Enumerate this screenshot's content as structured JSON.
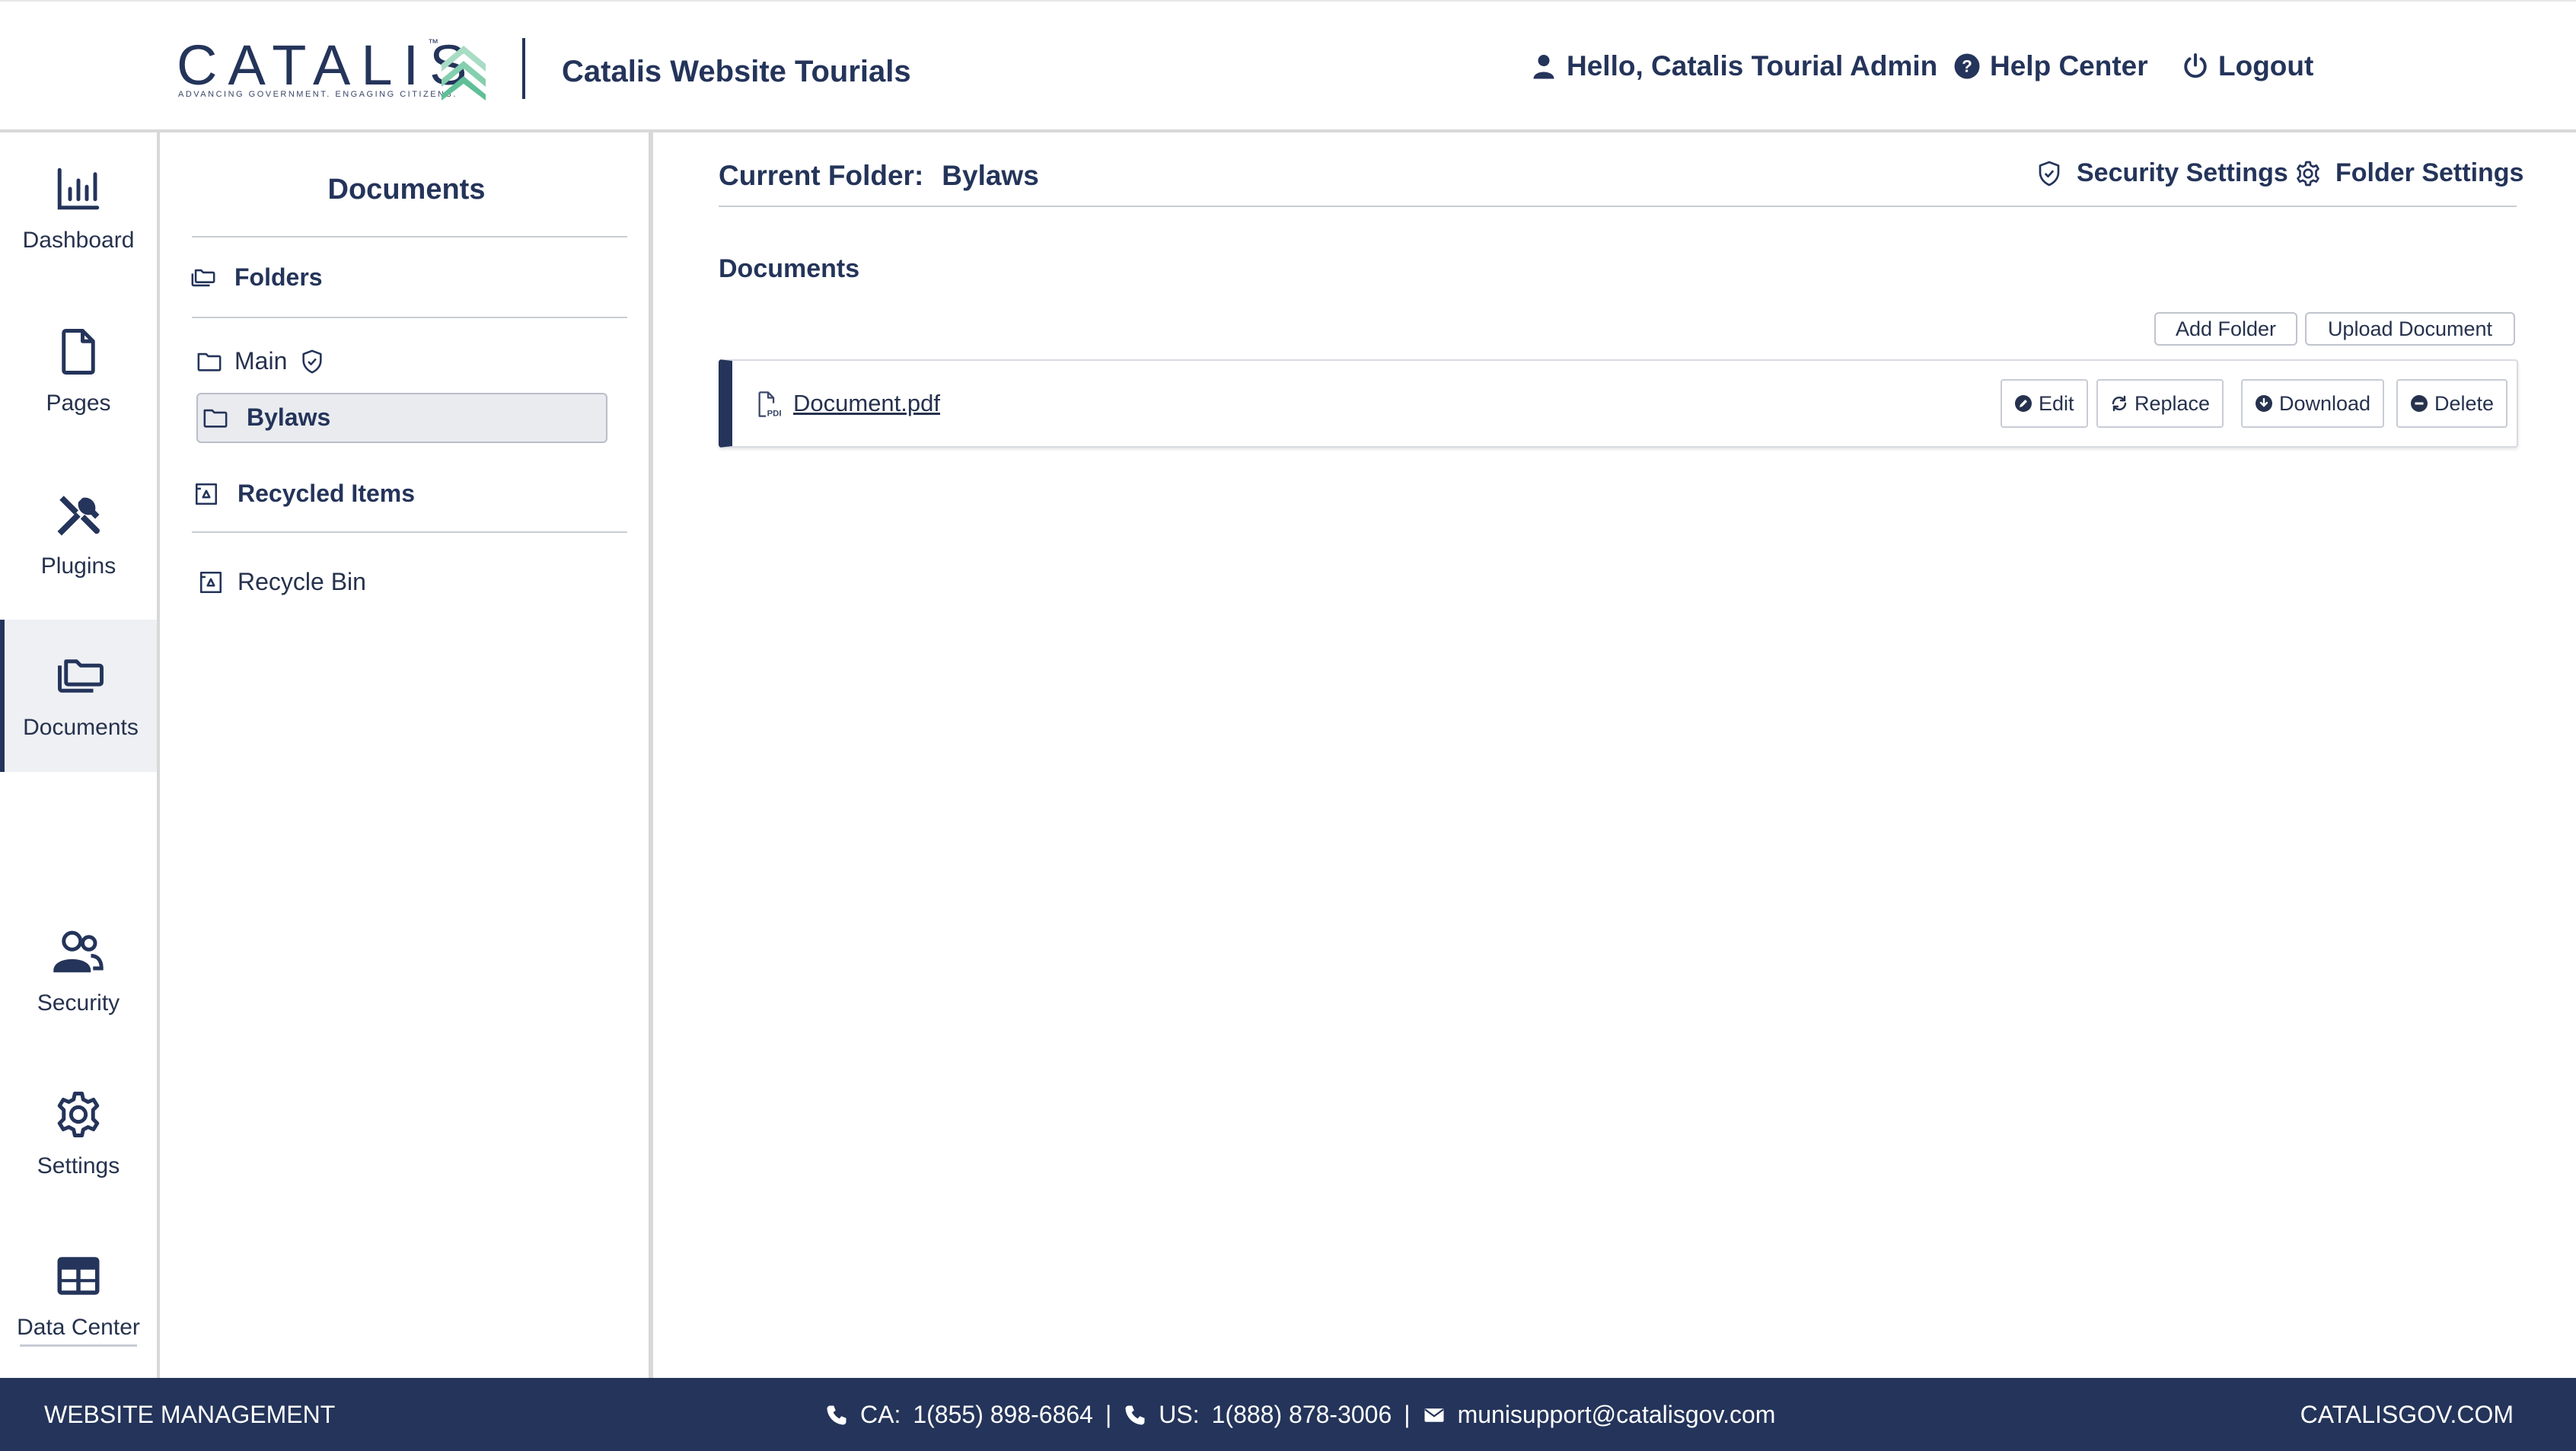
{
  "header": {
    "logo_text": "CATALIS",
    "logo_tagline": "ADVANCING GOVERNMENT. ENGAGING CITIZENS.",
    "app_title": "Catalis Website Tourials",
    "greeting": "Hello, Catalis Tourial Admin",
    "help_label": "Help Center",
    "logout_label": "Logout"
  },
  "nav": {
    "items": [
      {
        "label": "Dashboard",
        "icon": "bar-chart-icon"
      },
      {
        "label": "Pages",
        "icon": "page-icon"
      },
      {
        "label": "Plugins",
        "icon": "tools-icon"
      },
      {
        "label": "Documents",
        "icon": "folders-icon",
        "active": true
      },
      {
        "label": "Security",
        "icon": "users-icon"
      },
      {
        "label": "Settings",
        "icon": "gear-icon"
      },
      {
        "label": "Data Center",
        "icon": "table-icon"
      }
    ]
  },
  "panel": {
    "title": "Documents",
    "folders_heading": "Folders",
    "folders": [
      {
        "name": "Main",
        "secured": true
      },
      {
        "name": "Bylaws",
        "selected": true
      }
    ],
    "recycled_heading": "Recycled Items",
    "recycle_bin": "Recycle Bin"
  },
  "main": {
    "current_folder_label": "Current Folder:",
    "current_folder_value": "Bylaws",
    "security_settings_label": "Security Settings",
    "folder_settings_label": "Folder Settings",
    "documents_heading": "Documents",
    "add_folder_label": "Add Folder",
    "upload_document_label": "Upload Document",
    "documents": [
      {
        "name": "Document.pdf",
        "type": "PDF"
      }
    ],
    "actions": {
      "edit": "Edit",
      "replace": "Replace",
      "download": "Download",
      "delete": "Delete"
    }
  },
  "footer": {
    "left": "WEBSITE MANAGEMENT",
    "ca_label": "CA:",
    "ca_phone": "1(855) 898-6864",
    "us_label": "US:",
    "us_phone": "1(888) 878-3006",
    "separator": "|",
    "email": "munisupport@catalisgov.com",
    "right": "CATALISGOV.COM"
  },
  "colors": {
    "brand_navy": "#24345a",
    "brand_green": "#6fc4a0",
    "active_bg": "#eef0f4"
  }
}
